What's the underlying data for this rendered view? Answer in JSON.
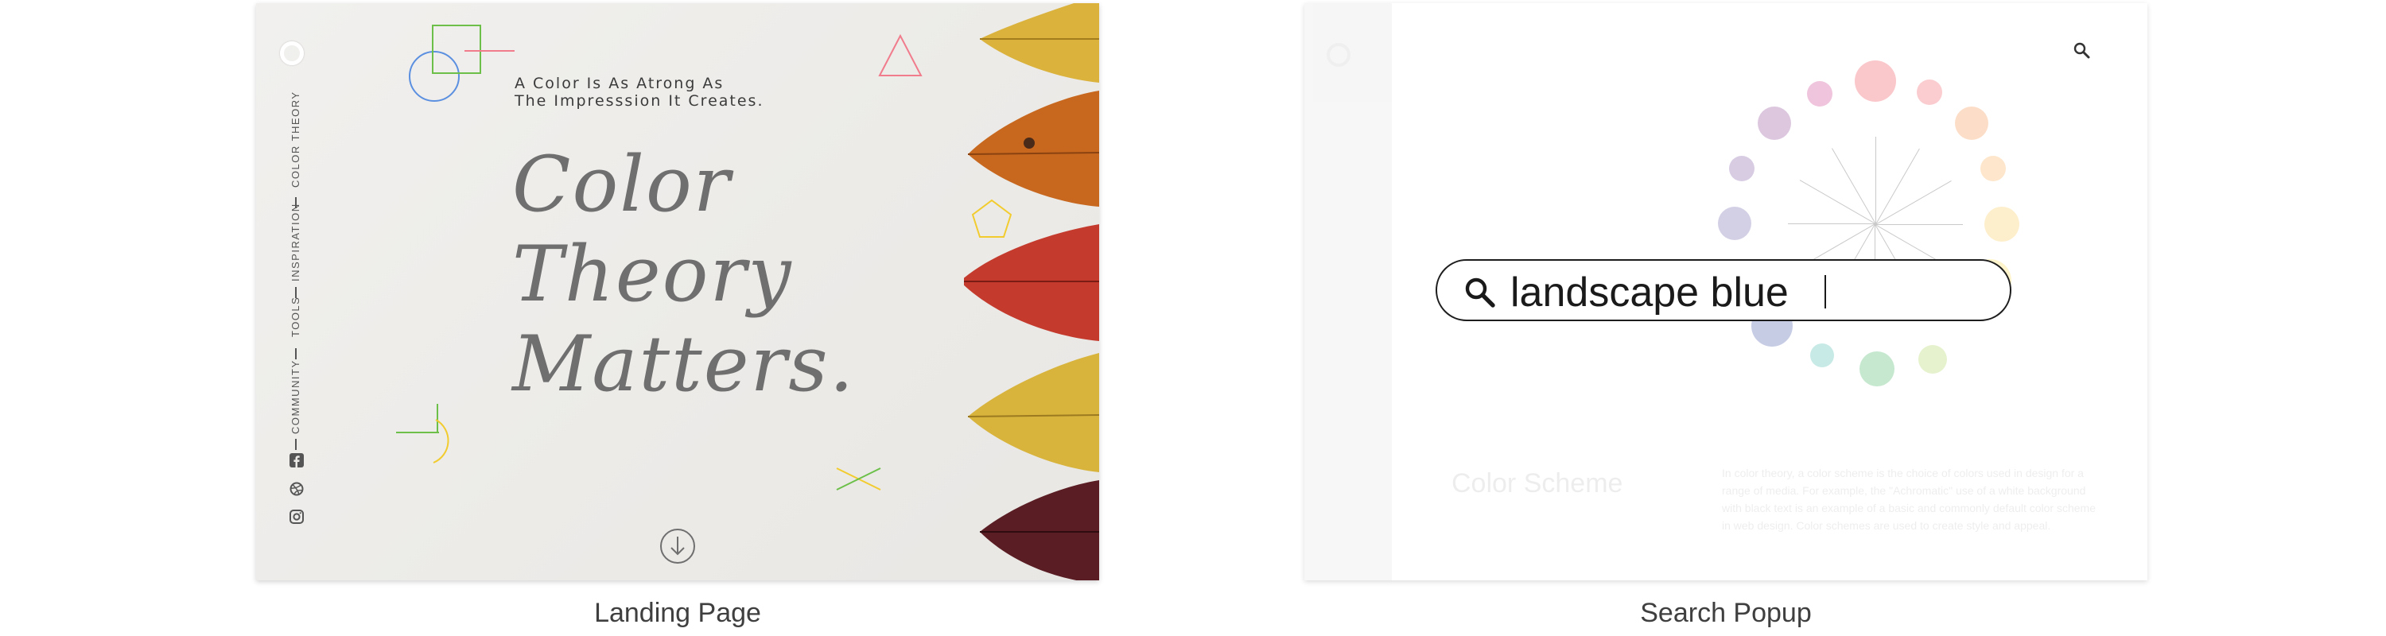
{
  "landing_page": {
    "caption": "Landing Page",
    "nav_items": [
      "COLOR THEORY",
      "INSPIRATION",
      "TOOLS",
      "COMMUNITY"
    ],
    "social_icons": [
      "facebook-icon",
      "dribbble-icon",
      "instagram-icon"
    ],
    "tagline_line1": "A Color Is As Atrong As",
    "tagline_line2": "The Impresssion It Creates.",
    "hero_line1": "Color",
    "hero_line2": "Theory",
    "hero_line3": "Matters.",
    "colors": {
      "leaf_yellow": "#d8b23a",
      "leaf_orange": "#c9661f",
      "leaf_red": "#c23a2e",
      "leaf_dark": "#5a1c22",
      "shape_green": "#6cc04a",
      "shape_blue": "#5b8fe0",
      "shape_pink": "#f07c8c",
      "shape_yellow": "#f2cc2e"
    }
  },
  "search_popup": {
    "caption": "Search Popup",
    "search_value": "landscape blue",
    "bg_section_title": "Color Scheme",
    "bg_paragraph": "In color theory, a color scheme is the choice of colors used in design for a range of media. For example, the \"Achromatic\" use of a white background with black text is an example of a basic and commonly default color scheme in web design. Color schemes are used to create style and appeal."
  }
}
